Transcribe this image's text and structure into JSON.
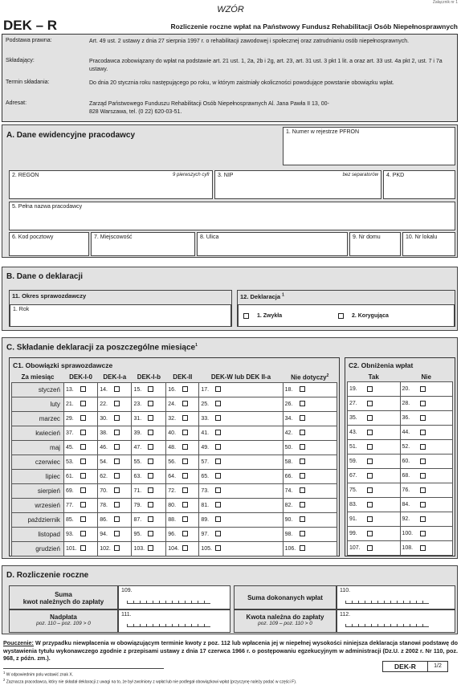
{
  "top": {
    "corner": "Załącznik nr 1",
    "wzor": "WZÓR",
    "code": "DEK – R",
    "title": "Rozliczenie roczne wpłat na Państwowy Fundusz Rehabilitacji Osób Niepełnosprawnych"
  },
  "info": [
    {
      "label": "Podstawa prawna:",
      "text": "Art. 49 ust. 2 ustawy z dnia 27 sierpnia 1997 r. o rehabilitacji zawodowej i społecznej oraz zatrudnianiu osób niepełnosprawnych."
    },
    {
      "label": "Składający:",
      "text": "Pracodawca zobowiązany do wpłat na podstawie art. 21 ust. 1, 2a, 2b i 2g, art. 23, art. 31 ust. 3 pkt 1 lit. a oraz art. 33 ust. 4a pkt 2, ust. 7 i 7a ustawy."
    },
    {
      "label": "Termin składania:",
      "text": "Do dnia 20 stycznia roku następującego po roku, w którym zaistniały okoliczności powodujące powstanie obowiązku wpłat."
    },
    {
      "label": "Adresat:",
      "text": "Zarząd Państwowego Funduszu Rehabilitacji Osób Niepełnosprawnych Al. Jana Pawła II 13, 00-828 Warszawa, tel. (0 22) 620-03-51."
    }
  ],
  "a": {
    "title": "A. Dane ewidencyjne pracodawcy",
    "f1": "1. Numer w rejestrze PFRON",
    "f2": "2. REGON",
    "f2h": "9 pierwszych cyfr",
    "f3": "3. NIP",
    "f3h": "bez separatorów",
    "f4": "4. PKD",
    "f5": "5. Pełna nazwa pracodawcy",
    "f6": "6. Kod pocztowy",
    "f7": "7. Miejscowość",
    "f8": "8. Ulica",
    "f9": "9. Nr domu",
    "f10": "10. Nr lokalu"
  },
  "b": {
    "title": "B. Dane o deklaracji",
    "f11": "11. Okres sprawozdawczy",
    "rok": "1. Rok",
    "f12": "12. Deklaracja",
    "f12sup": "1",
    "opt1": "1. Zwykła",
    "opt2": "2. Korygująca"
  },
  "c": {
    "title": "C. Składanie deklaracji za poszczególne miesiące",
    "sup": "1",
    "c1": "C1. Obowiązki sprawozdawcze",
    "c2": "C2. Obniżenia wpłat",
    "heads": [
      "Za miesiąc",
      "DEK-I-0",
      "DEK-I-a",
      "DEK-I-b",
      "DEK-II",
      "DEK-W lub DEK II-a",
      "Nie dotyczy"
    ],
    "nd_sup": "2",
    "c2heads": [
      "Tak",
      "Nie"
    ],
    "rows": [
      {
        "m": "styczeń",
        "n": [
          "13.",
          "14.",
          "15.",
          "16.",
          "17.",
          "18.",
          "19.",
          "20."
        ]
      },
      {
        "m": "luty",
        "n": [
          "21.",
          "22.",
          "23.",
          "24.",
          "25.",
          "26.",
          "27.",
          "28."
        ]
      },
      {
        "m": "marzec",
        "n": [
          "29.",
          "30.",
          "31.",
          "32.",
          "33.",
          "34.",
          "35.",
          "36."
        ]
      },
      {
        "m": "kwiecień",
        "n": [
          "37.",
          "38.",
          "39.",
          "40.",
          "41.",
          "42.",
          "43.",
          "44."
        ]
      },
      {
        "m": "maj",
        "n": [
          "45.",
          "46.",
          "47.",
          "48.",
          "49.",
          "50.",
          "51.",
          "52."
        ]
      },
      {
        "m": "czerwiec",
        "n": [
          "53.",
          "54.",
          "55.",
          "56.",
          "57.",
          "58.",
          "59.",
          "60."
        ]
      },
      {
        "m": "lipiec",
        "n": [
          "61.",
          "62.",
          "63.",
          "64.",
          "65.",
          "66.",
          "67.",
          "68."
        ]
      },
      {
        "m": "sierpień",
        "n": [
          "69.",
          "70.",
          "71.",
          "72.",
          "73.",
          "74.",
          "75.",
          "76."
        ]
      },
      {
        "m": "wrzesień",
        "n": [
          "77.",
          "78.",
          "79.",
          "80.",
          "81.",
          "82.",
          "83.",
          "84."
        ]
      },
      {
        "m": "październik",
        "n": [
          "85.",
          "86.",
          "87.",
          "88.",
          "89.",
          "90.",
          "91.",
          "92."
        ]
      },
      {
        "m": "listopad",
        "n": [
          "93.",
          "94.",
          "95.",
          "96.",
          "97.",
          "98.",
          "99.",
          "100."
        ]
      },
      {
        "m": "grudzień",
        "n": [
          "101.",
          "102.",
          "103.",
          "104.",
          "105.",
          "106.",
          "107.",
          "108."
        ]
      }
    ]
  },
  "d": {
    "title": "D. Rozliczenie roczne",
    "l1a": "Suma",
    "l1b": "kwot należnych do zapłaty",
    "n109": "109.",
    "l2": "Suma dokonanych wpłat",
    "n110": "110.",
    "l3a": "Nadpłata",
    "l3b": "poz. 110 – poz. 109 > 0",
    "n111": "111.",
    "l4a": "Kwota należna do zapłaty",
    "l4b": "poz. 109 – poz. 110 > 0",
    "n112": "112."
  },
  "pouczenie": {
    "label": "Pouczenie:",
    "text": " W przypadku niewpłacenia w obowiązującym terminie kwoty z poz. 112 lub wpłacenia jej w niepełnej wysokości niniejsza deklaracja stanowi podstawę do wystawienia tytułu wykonawczego zgodnie z przepisami ustawy z dnia 17 czerwca 1966 r. o postępowaniu egzekucyjnym w administracji (Dz.U. z 2002 r. Nr 110, poz. 968, z późn. zm.)."
  },
  "foot": {
    "n1": "W odpowiednim polu wstawić znak X.",
    "n2": "Zaznacza pracodawca, który nie składał deklaracji z uwagi na to, że był zwolniony z wpłat lub nie podlegał obowiązkowi wpłat (przyczynę należy podać w części F).",
    "code": "DEK-R",
    "page": "1/2"
  }
}
